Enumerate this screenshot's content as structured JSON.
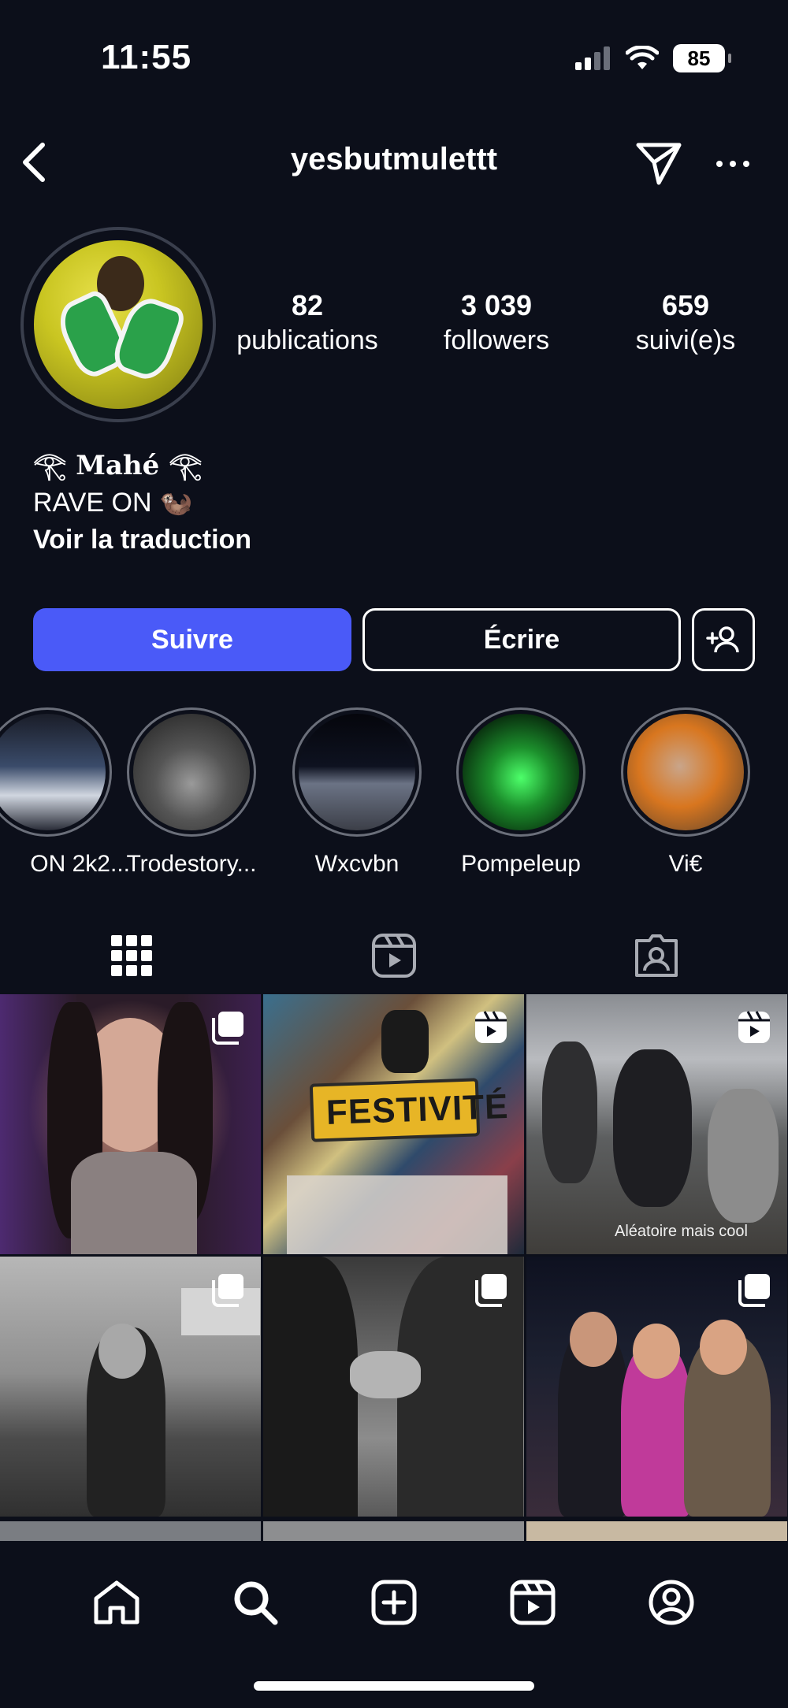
{
  "status_bar": {
    "time": "11:55",
    "battery": "85"
  },
  "header": {
    "username": "yesbutmulettt"
  },
  "profile": {
    "stats": [
      {
        "value": "82",
        "label": "publications"
      },
      {
        "value": "3 039",
        "label": "followers"
      },
      {
        "value": "659",
        "label": "suivi(e)s"
      }
    ],
    "bio": {
      "name": "𓂀 Mahé 𓂀",
      "line": "RAVE ON 🦦",
      "translate": "Voir la traduction"
    }
  },
  "actions": {
    "follow_label": "Suivre",
    "write_label": "Écrire"
  },
  "highlights": [
    {
      "label": "ON 2k2..."
    },
    {
      "label": "Trodestory..."
    },
    {
      "label": "Wxcvbn"
    },
    {
      "label": "Pompeleup"
    },
    {
      "label": "Vi€"
    }
  ],
  "tabs": [
    "grid-icon",
    "reels-icon",
    "tagged-icon"
  ],
  "posts": [
    {
      "badge": "carousel",
      "text": ""
    },
    {
      "badge": "reel",
      "text": "FESTIVITÉ"
    },
    {
      "badge": "reel",
      "text": "Aléatoire mais cool"
    },
    {
      "badge": "carousel",
      "text": ""
    },
    {
      "badge": "carousel",
      "text": ""
    },
    {
      "badge": "carousel",
      "text": ""
    }
  ],
  "bottom_nav": [
    "home-icon",
    "search-icon",
    "create-icon",
    "reels-icon",
    "profile-icon"
  ],
  "colors": {
    "background": "#0c0f1a",
    "follow_button": "#4a5af8"
  }
}
